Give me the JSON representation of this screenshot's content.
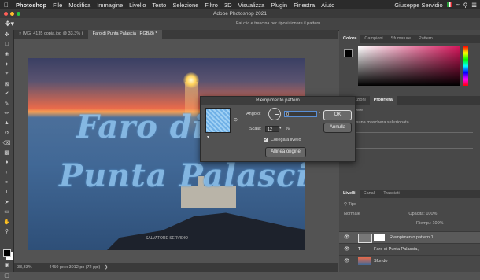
{
  "menubar": {
    "apple": "",
    "items": [
      "Photoshop",
      "File",
      "Modifica",
      "Immagine",
      "Livello",
      "Testo",
      "Selezione",
      "Filtro",
      "3D",
      "Visualizza",
      "Plugin",
      "Finestra",
      "Aiuto"
    ],
    "user": "Giuseppe Servidio"
  },
  "titlebar": {
    "title": "Adobe Photoshop 2021"
  },
  "options": {
    "hint": "Fai clic e trascina per riposizionare il pattern."
  },
  "doc_tabs": [
    {
      "label": "IMG_4135 copia.jpg @ 33,3% (",
      "close": "×"
    },
    {
      "label": "Faro di  Punta Palascia , RGB/8) *"
    }
  ],
  "canvas": {
    "text_line1": "Faro di",
    "text_line2": "Punta Palascia",
    "watermark": "SALVATORE SERVIDIO"
  },
  "status": {
    "zoom": "33,33%",
    "size": "4450 px x 3012 px (72 ppi)"
  },
  "panels": {
    "color_tabs": [
      "Colore",
      "Campioni",
      "Sfumature",
      "Pattern"
    ],
    "props_tabs": [
      "Regolazioni",
      "Proprietà"
    ],
    "props_mask": "Maschere",
    "props_mask_sel": "Nessuna maschera selezionata",
    "layers_tabs": [
      "Livelli",
      "Canali",
      "Tracciati"
    ],
    "layer_kind": "Tipo",
    "layer_mode": "Normale",
    "layer_opacity_label": "Opacità:",
    "layer_opacity": "100%",
    "layer_fill_label": "Riemp.:",
    "layer_fill": "100%",
    "layers": [
      {
        "name": "Riempimento pattern 1",
        "selected": true
      },
      {
        "name": "Faro di  Punta Palascia,",
        "selected": false
      },
      {
        "name": "Sfondo",
        "selected": false
      }
    ]
  },
  "dialog": {
    "title": "Riempimento pattern",
    "angle_label": "Angolo:",
    "angle_value": "0",
    "angle_unit": "°",
    "scale_label": "Scala:",
    "scale_value": "12",
    "scale_unit": "%",
    "link_label": "Collega a livello",
    "align_button": "Allinea origine",
    "ok_button": "OK",
    "cancel_button": "Annulla"
  }
}
